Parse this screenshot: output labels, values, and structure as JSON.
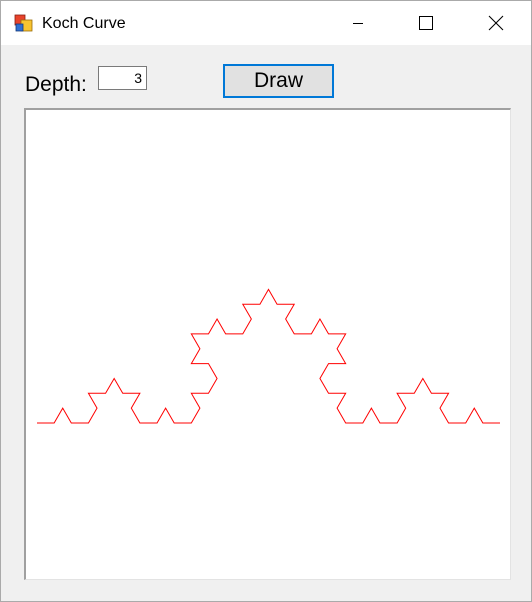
{
  "window": {
    "title": "Koch Curve",
    "icon": "winforms-app-icon",
    "controls": [
      "minimize-icon",
      "maximize-icon",
      "close-icon"
    ]
  },
  "toolbar": {
    "depth_label": "Depth:",
    "depth_value": "3",
    "draw_label": "Draw"
  },
  "curve": {
    "depth": 3,
    "stroke_color": "#ff0000",
    "background": "#ffffff"
  },
  "colors": {
    "accent": "#0078d7",
    "window_bg": "#f0f0f0"
  }
}
